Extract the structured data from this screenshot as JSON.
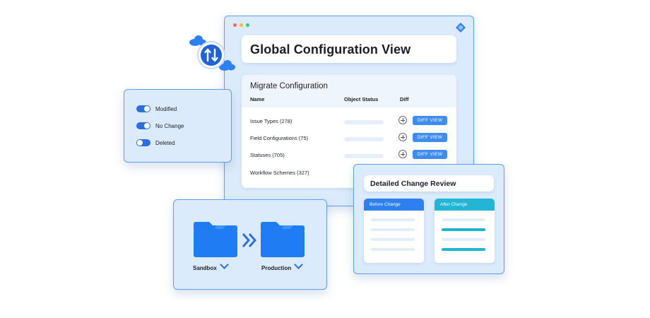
{
  "main": {
    "title": "Global Configuration View",
    "window_dots": [
      "#f06a5b",
      "#f5b93c",
      "#3cc86a"
    ],
    "migrate": {
      "title": "Migrate Configuration",
      "columns": [
        "Name",
        "Object Status",
        "Diff"
      ],
      "rows": [
        {
          "name": "Issue Types (278)",
          "diff_label": "DIFF VIEW"
        },
        {
          "name": "Field Configurations (75)",
          "diff_label": "DIFF VIEW"
        },
        {
          "name": "Statuses (705)",
          "diff_label": "DIFF VIEW"
        },
        {
          "name": "Workflow Schemes (327)",
          "diff_label": ""
        }
      ]
    }
  },
  "toggles": [
    {
      "label": "Modified",
      "on": true
    },
    {
      "label": "No Change",
      "on": true
    },
    {
      "label": "Deleted",
      "on": false
    }
  ],
  "folders": {
    "source": "Sandbox",
    "target": "Production"
  },
  "review": {
    "title": "Detailed Change Review",
    "before_label": "Before Change",
    "after_label": "After Change"
  },
  "colors": {
    "accent": "#3d8cf0",
    "before_header": "#2e7ff0",
    "after_header": "#22b6d4",
    "folder": "#1f7cf3",
    "panel_bg": "#dcebfb"
  },
  "icons": [
    "sync-arrows-icon",
    "cloud-icon",
    "folder-icon",
    "double-chevron-right-icon",
    "chevron-down-icon",
    "plus-circle-icon",
    "logo-icon"
  ]
}
